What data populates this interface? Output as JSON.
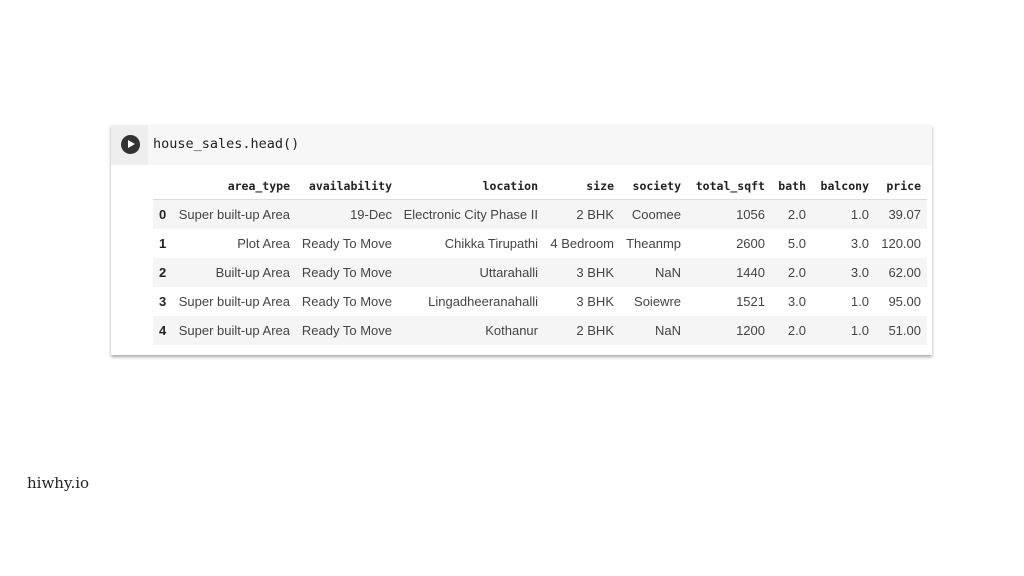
{
  "cell": {
    "code": "house_sales.head()",
    "run_icon": "play-circle-icon"
  },
  "table": {
    "columns": [
      "",
      "area_type",
      "availability",
      "location",
      "size",
      "society",
      "total_sqft",
      "bath",
      "balcony",
      "price"
    ],
    "rows": [
      [
        "0",
        "Super built-up Area",
        "19-Dec",
        "Electronic City Phase II",
        "2 BHK",
        "Coomee",
        "1056",
        "2.0",
        "1.0",
        "39.07"
      ],
      [
        "1",
        "Plot Area",
        "Ready To Move",
        "Chikka Tirupathi",
        "4 Bedroom",
        "Theanmp",
        "2600",
        "5.0",
        "3.0",
        "120.00"
      ],
      [
        "2",
        "Built-up Area",
        "Ready To Move",
        "Uttarahalli",
        "3 BHK",
        "NaN",
        "1440",
        "2.0",
        "3.0",
        "62.00"
      ],
      [
        "3",
        "Super built-up Area",
        "Ready To Move",
        "Lingadheeranahalli",
        "3 BHK",
        "Soiewre",
        "1521",
        "3.0",
        "1.0",
        "95.00"
      ],
      [
        "4",
        "Super built-up Area",
        "Ready To Move",
        "Kothanur",
        "2 BHK",
        "NaN",
        "1200",
        "2.0",
        "1.0",
        "51.00"
      ]
    ]
  },
  "watermark": "hiwhy.io"
}
